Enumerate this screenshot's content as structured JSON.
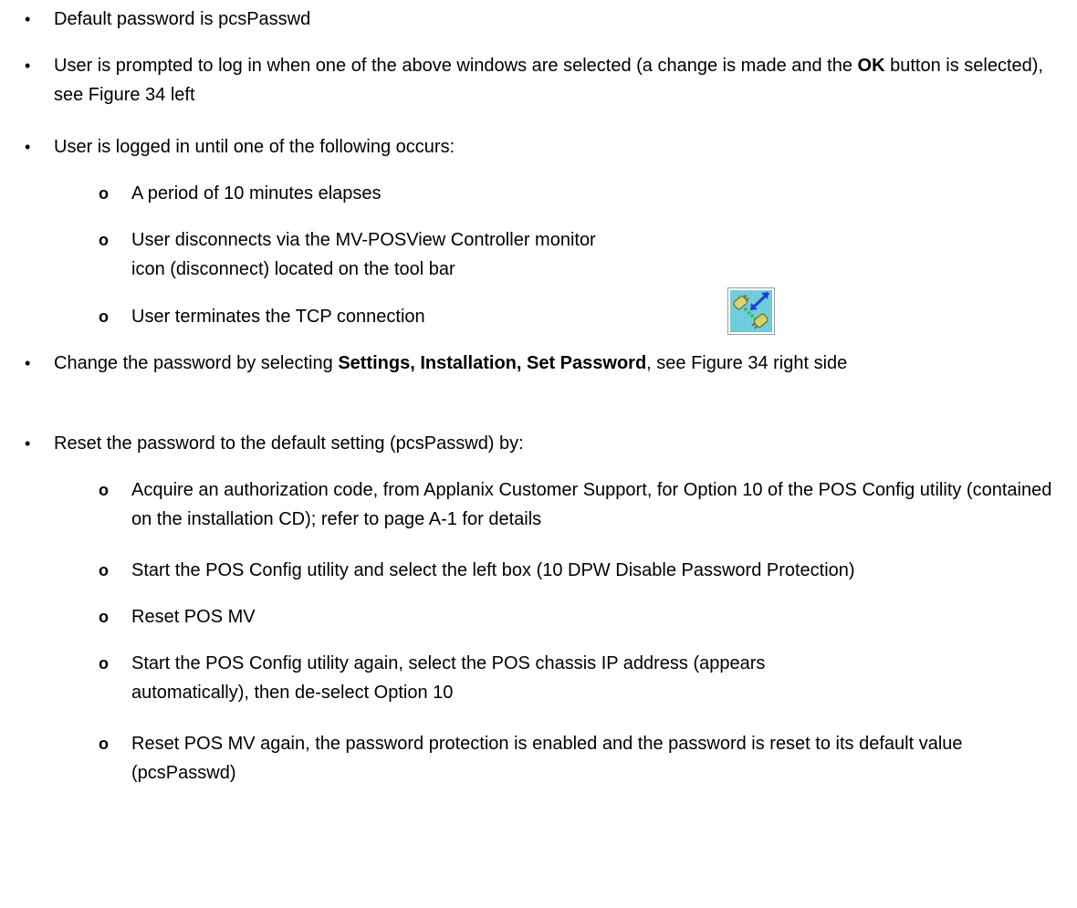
{
  "bullets": {
    "b1": "Default password is pcsPasswd",
    "b2_a": "User is prompted to log in when one of the above windows are selected (a change is made and the ",
    "b2_bold": "OK",
    "b2_b": " button is selected), see Figure 34 left",
    "b3": "User is logged in until one of the following occurs:",
    "b3_sub1": "A period of 10 minutes elapses",
    "b3_sub2_line1": "User disconnects via the MV-POSView Controller monitor",
    "b3_sub2_line2": "icon (disconnect) located on the tool bar",
    "b3_sub3": "User terminates the TCP connection",
    "b4_a": "Change the password by selecting ",
    "b4_bold": "Settings, Installation, Set Password",
    "b4_b": ", see Figure 34 right side",
    "b5": "Reset the password to the default setting (pcsPasswd) by:",
    "b5_sub1": "Acquire an authorization code, from Applanix Customer Support, for Option 10 of the POS Config utility (contained on the installation CD); refer to page A-1 for details",
    "b5_sub2": "Start the POS Config utility and select the left box (10 DPW Disable Password Protection)",
    "b5_sub3": "Reset POS MV",
    "b5_sub4": "Start the POS Config utility again, select the POS chassis IP address (appears automatically), then de-select Option 10",
    "b5_sub5": "Reset POS MV again, the password protection is enabled and the password is reset to its default value (pcsPasswd)"
  },
  "markers": {
    "level1": "•",
    "level2": "o"
  },
  "icons": {
    "disconnect": "disconnect-icon"
  },
  "colors": {
    "text": "#000000",
    "icon_bg": "#63c6d6",
    "icon_arrow": "#1f3fd6",
    "icon_plug": "#d9d46a"
  }
}
